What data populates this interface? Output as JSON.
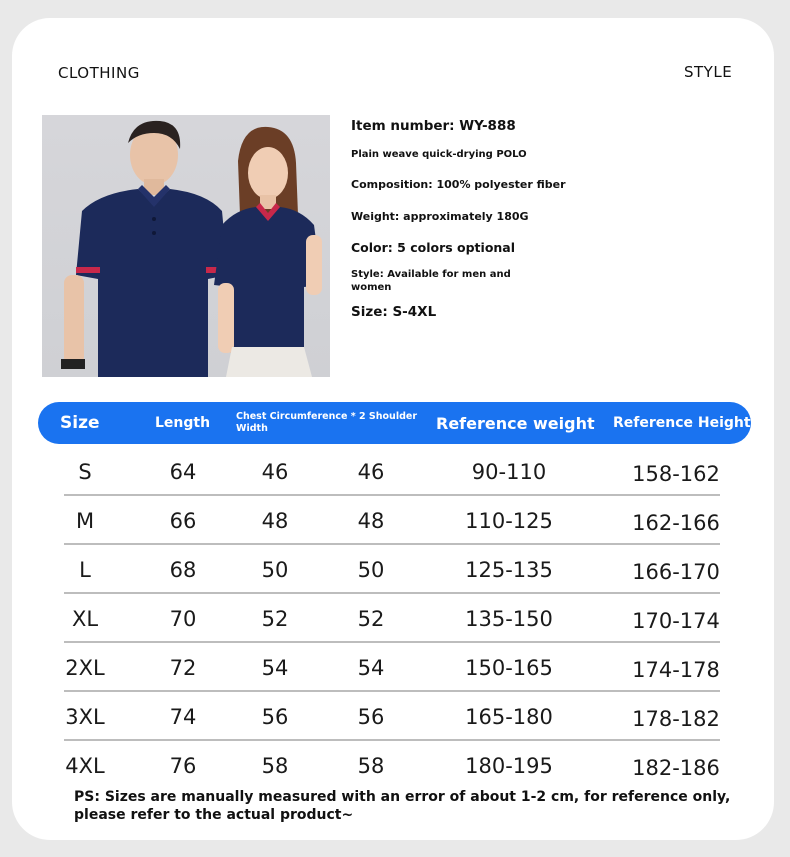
{
  "header": {
    "left_label": "CLOTHING",
    "right_label": "STYLE"
  },
  "photo": {
    "description_icon": "models-wearing-navy-polo-icon",
    "shirt_color": "#1c2a5a",
    "collar_trim": "#c8284a"
  },
  "info": {
    "item_number": "Item number: WY-888",
    "plain_weave": "Plain weave quick-drying POLO",
    "composition": "Composition: 100% polyester fiber",
    "weight": "Weight: approximately 180G",
    "color": "Color: 5 colors optional",
    "style": "Style: Available for men and women",
    "size": "Size: S-4XL"
  },
  "table": {
    "header_color": "#1a73f0",
    "headers": [
      "Size",
      "Length",
      "Chest Circumference * 2 Shoulder Width",
      "Reference weight",
      "Reference Height"
    ],
    "rows": [
      [
        "S",
        "64",
        "46",
        "46",
        "90-110",
        "158-162"
      ],
      [
        "M",
        "66",
        "48",
        "48",
        "110-125",
        "162-166"
      ],
      [
        "L",
        "68",
        "50",
        "50",
        "125-135",
        "166-170"
      ],
      [
        "XL",
        "70",
        "52",
        "52",
        "135-150",
        "170-174"
      ],
      [
        "2XL",
        "72",
        "54",
        "54",
        "150-165",
        "174-178"
      ],
      [
        "3XL",
        "74",
        "56",
        "56",
        "165-180",
        "178-182"
      ],
      [
        "4XL",
        "76",
        "58",
        "58",
        "180-195",
        "182-186"
      ]
    ]
  },
  "note": "PS: Sizes are manually measured with an error of about 1-2 cm, for reference only, please refer to the actual product~"
}
